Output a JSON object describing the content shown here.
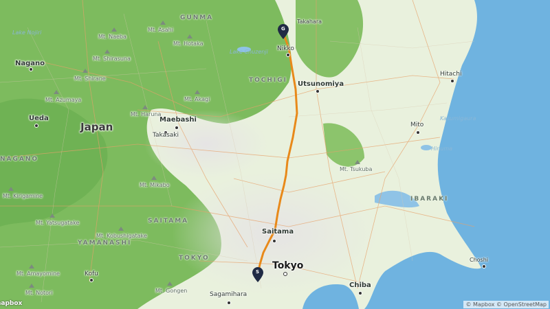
{
  "map": {
    "country": "Japan",
    "regions": [
      "GUNMA",
      "TOCHIGI",
      "NAGANO",
      "SAITAMA",
      "YAMANASHI",
      "TOKYO",
      "IBARAKI"
    ],
    "cities": {
      "nagano": "Nagano",
      "ueda": "Ueda",
      "maebashi": "Maebashi",
      "takasaki": "Takasaki",
      "utsunomiya": "Utsunomiya",
      "nikko": "Nikko",
      "hitachi": "Hitachi",
      "mito": "Mito",
      "saitama": "Saitama",
      "tokyo": "Tokyo",
      "chiba": "Chiba",
      "sagamihara": "Sagamihara",
      "kofu": "Kofu",
      "choshi": "Choshi",
      "takahara": "Takahara"
    },
    "peaks": {
      "naeba": "Mt. Naeba",
      "asahi": "Mt. Asahi",
      "hotaka": "Mt. Hotaka",
      "shirasuna": "Mt. Shirasuna",
      "shirane": "Mt. Shirane",
      "azumaya": "Mt. Azumaya",
      "akagi": "Mt. Akagi",
      "haruna": "Mt. Haruna",
      "tsukuba": "Mt. Tsukuba",
      "mikabo": "Mt. Mikabo",
      "kirigamine": "Mt. Kirigamine",
      "yatsugatake": "Mt. Yatsugatake",
      "kobushigatake": "Mt. Kobushigatake",
      "amayomine": "Mt. Amayomine",
      "gongen": "Mt. Gongen",
      "notori": "Mt. Notori"
    },
    "water": {
      "lake_chuzenji": "Lake Chuzenji",
      "lake_nojiri": "Lake Nojiri",
      "kasumigaura": "Kasumigaura",
      "hinuma": "Hinuma"
    },
    "markers": {
      "start": "S",
      "goal": "G"
    },
    "attribution": "© Mapbox © OpenStreetMap",
    "logo": "mapbox",
    "colors": {
      "route": "#e8891a",
      "land": "#e9f1dd",
      "forest": "#7dbb5e",
      "sea": "#6fb3e0",
      "urban": "#ececec"
    }
  }
}
